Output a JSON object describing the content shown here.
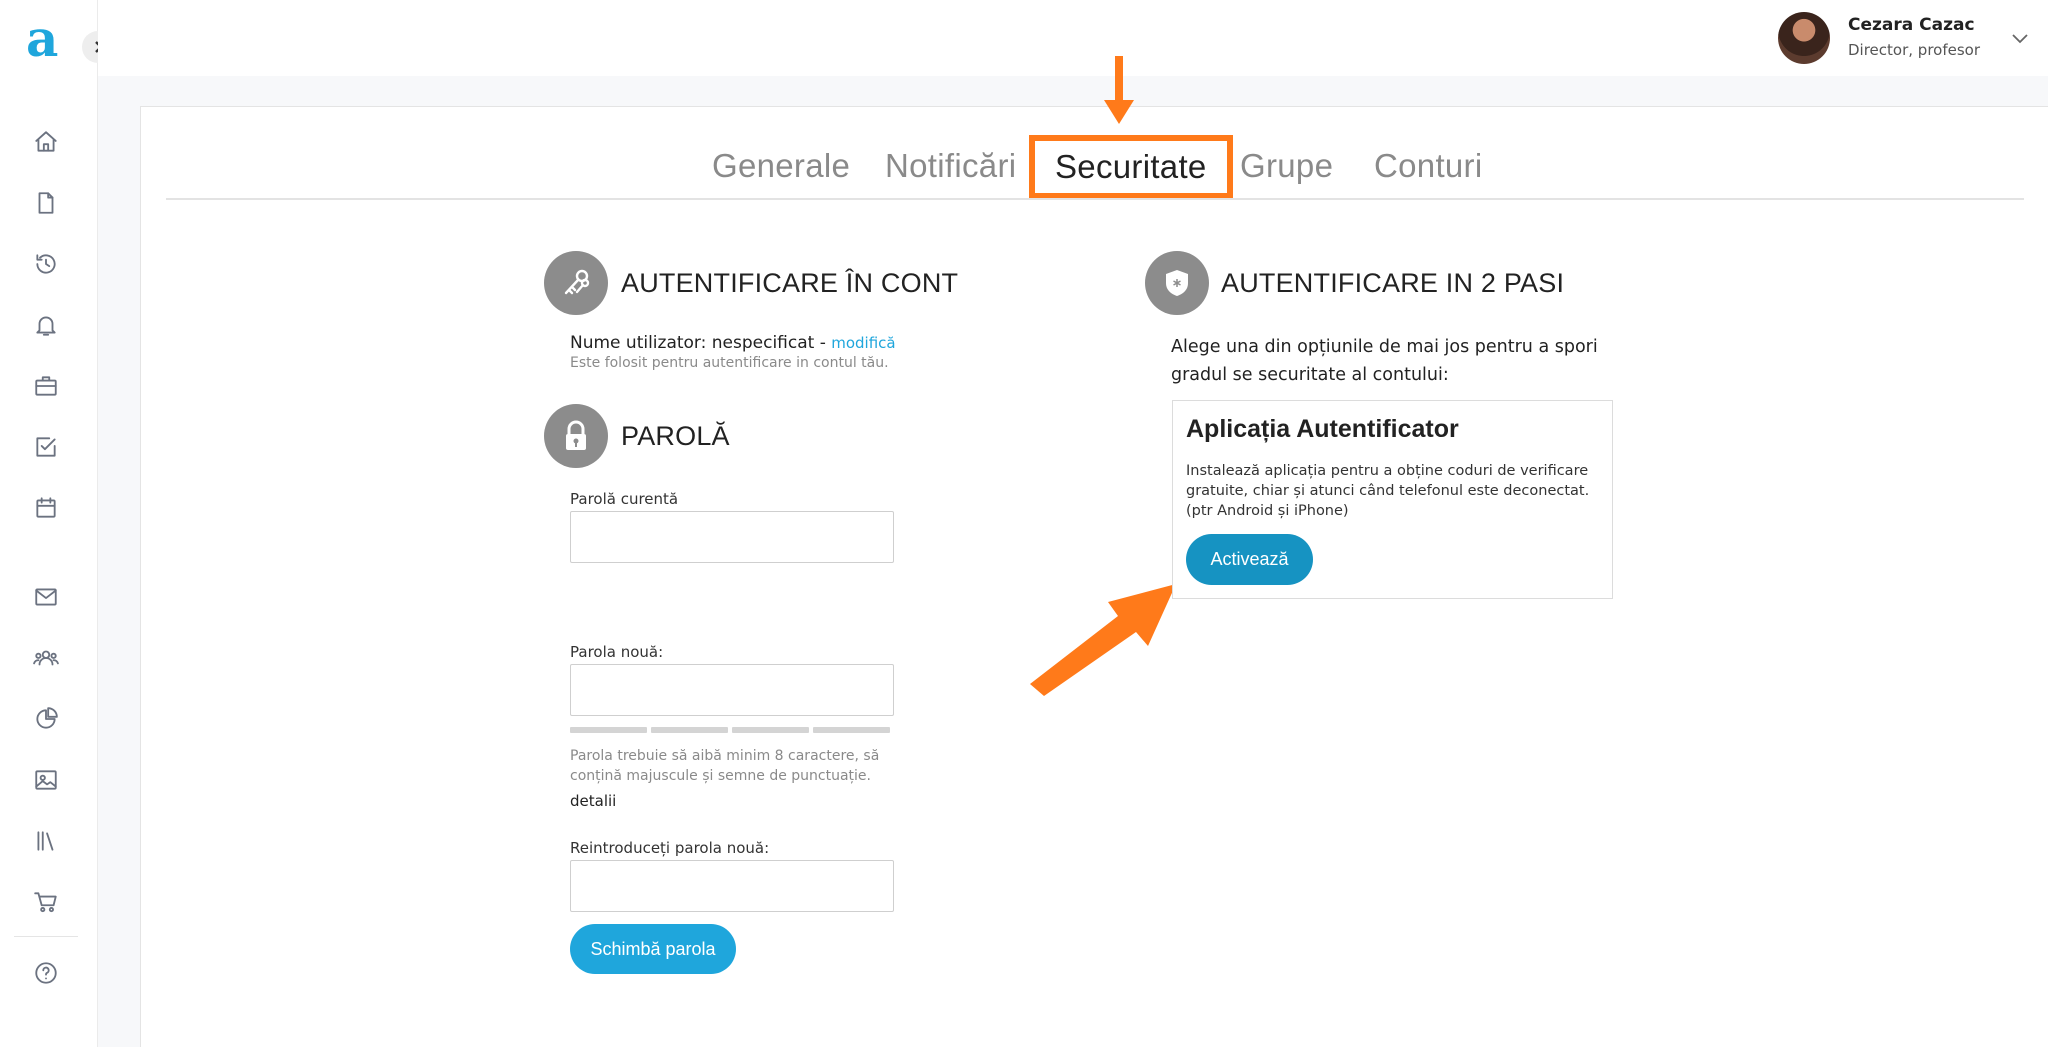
{
  "brand": {
    "logo_letter": "a",
    "accent": "#1fa6dc",
    "highlight": "#ff7a1a"
  },
  "user": {
    "name": "Cezara Cazac",
    "role": "Director, profesor"
  },
  "sidebar": {
    "icons": [
      "home-icon",
      "document-icon",
      "history-icon",
      "bell-icon",
      "briefcase-icon",
      "checklist-icon",
      "calendar-icon",
      "mail-icon",
      "users-icon",
      "chart-pie-icon",
      "image-icon",
      "library-icon",
      "cart-icon",
      "help-icon"
    ]
  },
  "tabs": [
    {
      "label": "Generale",
      "active": false
    },
    {
      "label": "Notificări",
      "active": false
    },
    {
      "label": "Securitate",
      "active": true
    },
    {
      "label": "Grupe",
      "active": false
    },
    {
      "label": "Conturi",
      "active": false
    }
  ],
  "account": {
    "title": "AUTENTIFICARE ÎN CONT",
    "username_prefix": "Nume utilizator: nespecificat - ",
    "modify_link": "modifică",
    "helper": "Este folosit pentru autentificare in contul tău."
  },
  "password": {
    "title": "PAROLĂ",
    "current_label": "Parolă curentă",
    "current_value": "",
    "new_label": "Parola nouă:",
    "new_value": "",
    "hint": "Parola trebuie să aibă minim 8 caractere, să conțină majuscule și semne de punctuație.",
    "details_link": "detalii",
    "repeat_label": "Reintroduceți parola nouă:",
    "repeat_value": "",
    "submit_label": "Schimbă parola"
  },
  "two_factor": {
    "title": "AUTENTIFICARE IN 2 PASI",
    "intro": "Alege una din opțiunile de mai jos pentru a spori gradul se securitate al contului:",
    "card_title": "Aplicația Autentificator",
    "card_text": "Instalează aplicația pentru a obține coduri de verificare gratuite, chiar și atunci când telefonul este deconectat. (ptr Android și iPhone)",
    "activate_label": "Activează",
    "button_color": "#1693c2"
  }
}
